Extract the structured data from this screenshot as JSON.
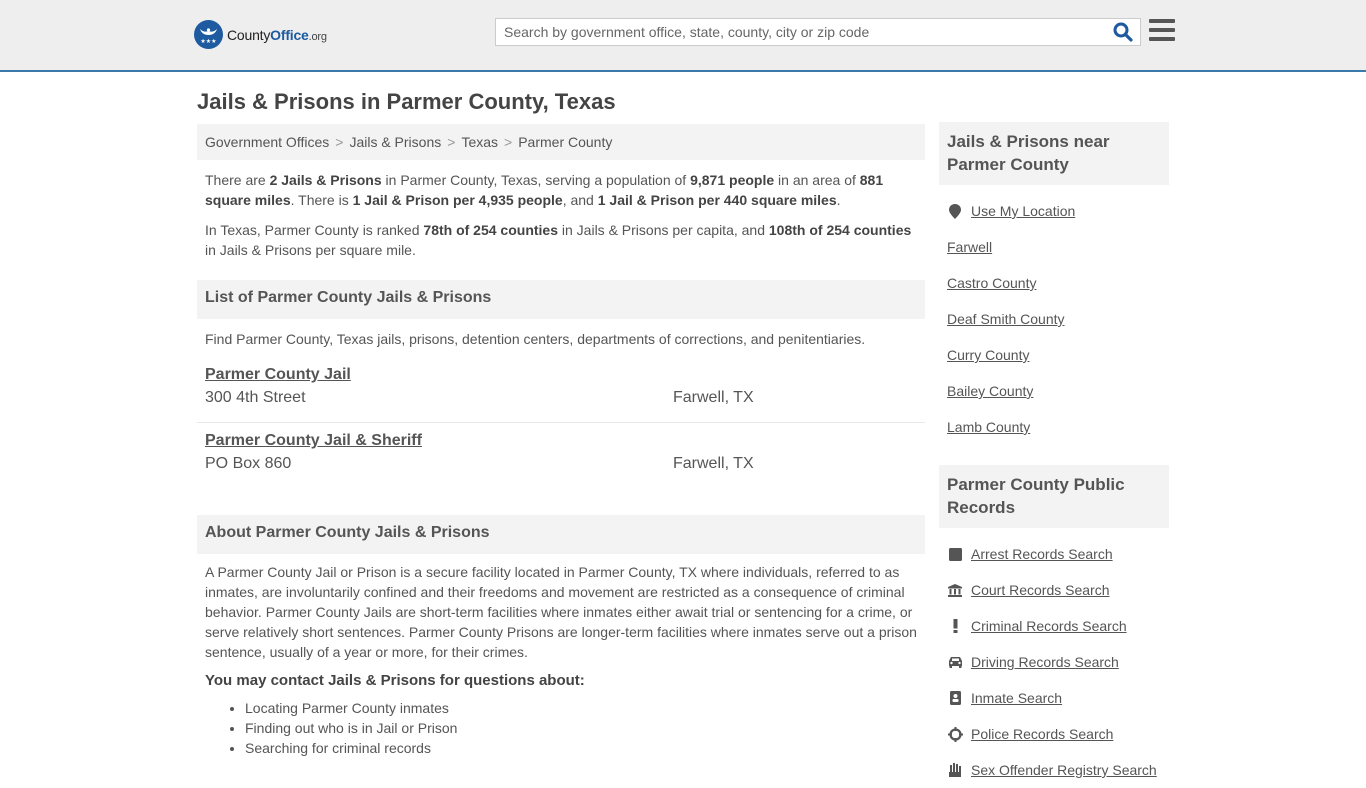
{
  "header": {
    "logo_text_main": "County",
    "logo_text_brand": "Office",
    "logo_text_tld": ".org",
    "search_placeholder": "Search by government office, state, county, city or zip code",
    "search_icon": "magnifier-icon",
    "menu_icon": "hamburger-icon"
  },
  "page_title": "Jails & Prisons in Parmer County, Texas",
  "breadcrumb": [
    {
      "label": "Government Offices"
    },
    {
      "label": "Jails & Prisons"
    },
    {
      "label": "Texas"
    },
    {
      "label": "Parmer County"
    }
  ],
  "breadcrumb_separator": ">",
  "intro": {
    "p1": {
      "t1": "There are ",
      "b1": "2 Jails & Prisons",
      "t2": " in Parmer County, Texas, serving a population of ",
      "b2": "9,871 people",
      "t3": " in an area of ",
      "b3": "881 square miles",
      "t4": ". There is ",
      "b4": "1 Jail & Prison per 4,935 people",
      "t5": ", and ",
      "b5": "1 Jail & Prison per 440 square miles",
      "t6": "."
    },
    "p2": {
      "t1": "In Texas, Parmer County is ranked ",
      "b1": "78th of 254 counties",
      "t2": " in Jails & Prisons per capita, and ",
      "b2": "108th of 254 counties",
      "t3": " in Jails & Prisons per square mile."
    }
  },
  "list_section": {
    "heading": "List of Parmer County Jails & Prisons",
    "description": "Find Parmer County, Texas jails, prisons, detention centers, departments of corrections, and penitentiaries.",
    "items": [
      {
        "name": "Parmer County Jail",
        "address": "300 4th Street",
        "city": "Farwell, TX"
      },
      {
        "name": "Parmer County Jail & Sheriff",
        "address": "PO Box 860",
        "city": "Farwell, TX"
      }
    ]
  },
  "about_section": {
    "heading": "About Parmer County Jails & Prisons",
    "text": "A Parmer County Jail or Prison is a secure facility located in Parmer County, TX where individuals, referred to as inmates, are involuntarily confined and their freedoms and movement are restricted as a consequence of criminal behavior. Parmer County Jails are short-term facilities where inmates either await trial or sentencing for a crime, or serve relatively short sentences. Parmer County Prisons are longer-term facilities where inmates serve out a prison sentence, usually of a year or more, for their crimes.",
    "contact_heading": "You may contact Jails & Prisons for questions about:",
    "bullets": [
      "Locating Parmer County inmates",
      "Finding out who is in Jail or Prison",
      "Searching for criminal records"
    ]
  },
  "sidebar": {
    "nearby": {
      "heading": "Jails & Prisons near Parmer County",
      "use_location": {
        "label": "Use My Location",
        "icon": "map-marker-icon"
      },
      "links": [
        "Farwell",
        "Castro County",
        "Deaf Smith County",
        "Curry County",
        "Bailey County",
        "Lamb County"
      ]
    },
    "public_records": {
      "heading": "Parmer County Public Records",
      "links": [
        {
          "label": "Arrest Records Search",
          "icon": "square-icon"
        },
        {
          "label": "Court Records Search",
          "icon": "courthouse-icon"
        },
        {
          "label": "Criminal Records Search",
          "icon": "exclamation-icon"
        },
        {
          "label": "Driving Records Search",
          "icon": "car-icon"
        },
        {
          "label": "Inmate Search",
          "icon": "id-badge-icon"
        },
        {
          "label": "Police Records Search",
          "icon": "crosshairs-icon"
        },
        {
          "label": "Sex Offender Registry Search",
          "icon": "hand-icon"
        }
      ]
    }
  },
  "colors": {
    "brand_blue": "#1d5aa0",
    "header_bg": "#eeeeee",
    "header_border": "#3a7bab",
    "panel_bg": "#f3f3f3",
    "text": "#555555"
  }
}
